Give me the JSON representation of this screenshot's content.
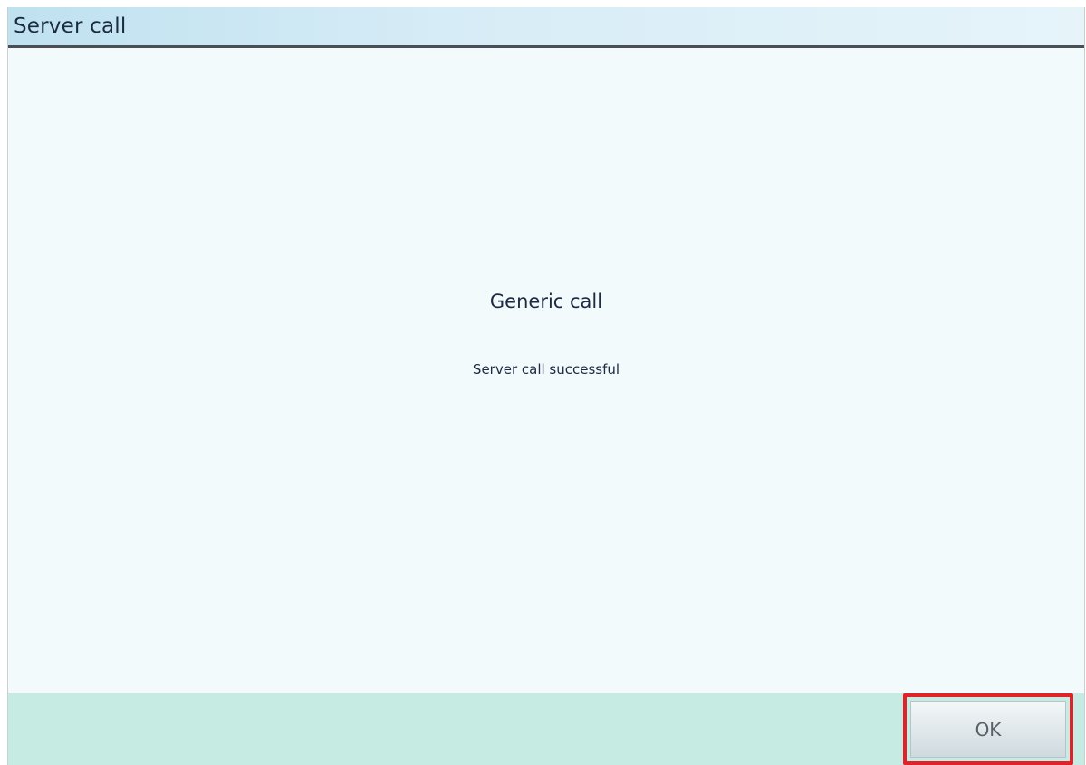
{
  "dialog": {
    "title": "Server call",
    "heading": "Generic call",
    "message": "Server call successful"
  },
  "footer": {
    "ok_label": "OK"
  },
  "colors": {
    "titlebar": "#d6ecf6",
    "content_background": "#f2fafb",
    "footer_background": "#c5ebe2",
    "highlight": "#e0232a"
  }
}
